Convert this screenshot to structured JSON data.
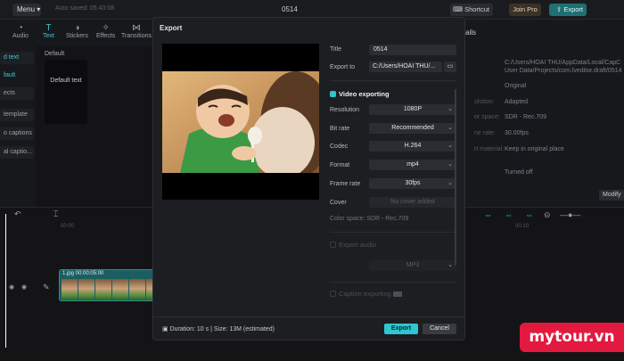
{
  "topbar": {
    "menu": "Menu",
    "autosave": "Auto saved: 05:43:08",
    "project": "0514",
    "shortcut": "Shortcut",
    "join_pro": "Join Pro",
    "export": "Export"
  },
  "toolbar": {
    "items": [
      {
        "label": "Audio",
        "icon": "audio-icon"
      },
      {
        "label": "Text",
        "icon": "text-icon"
      },
      {
        "label": "Stickers",
        "icon": "stickers-icon"
      },
      {
        "label": "Effects",
        "icon": "effects-icon"
      },
      {
        "label": "Transitions",
        "icon": "transitions-icon"
      }
    ]
  },
  "sidebar": {
    "items": [
      "d text",
      "fault",
      "ects",
      "template",
      "o captions",
      "al captio..."
    ]
  },
  "panel": {
    "default_label": "Default",
    "default_card": "Default text"
  },
  "details": {
    "title": "ails",
    "rows": [
      {
        "label": "",
        "value": "C:/Users/HOAI THU/AppData/Local/CapC"
      },
      {
        "label": "",
        "value": "User Data/Projects/com.lveditor.draft/0514"
      },
      {
        "label": "",
        "value": "Original"
      },
      {
        "label": "olution:",
        "value": "Adapted"
      },
      {
        "label": "or space:",
        "value": "SDR - Rec.709"
      },
      {
        "label": "ne rate:",
        "value": "30.00fps"
      },
      {
        "label": "rt material:",
        "value": "Keep in original place"
      },
      {
        "label": "",
        "value": "Turned off"
      }
    ],
    "modify": "Modify"
  },
  "timeline": {
    "times": [
      "00:00",
      "00:10"
    ],
    "clip_label": "1.jpg  00:00:05:00"
  },
  "modal": {
    "title": "Export",
    "fields": {
      "title_label": "Title",
      "title_value": "0514",
      "export_to_label": "Export to",
      "export_to_value": "C:/Users/HOAI THU/..."
    },
    "video_section": "Video exporting",
    "settings": [
      {
        "label": "Resolution",
        "value": "1080P"
      },
      {
        "label": "Bit rate",
        "value": "Recommended"
      },
      {
        "label": "Codec",
        "value": "H.264"
      },
      {
        "label": "Format",
        "value": "mp4"
      },
      {
        "label": "Frame rate",
        "value": "30fps"
      },
      {
        "label": "Cover",
        "value": "No cover added"
      }
    ],
    "color_space": "Color space: SDR - Rec.709",
    "audio_section": "Export audio",
    "audio_format": "MP3",
    "caption_section": "Caption exporting",
    "info": "Duration: 10 s | Size: 13M (estimated)",
    "export_btn": "Export",
    "cancel_btn": "Cancel"
  },
  "colors": {
    "accent": "#2ec6d0",
    "modal_bg": "#1d1e22",
    "watermark": "#e4193f"
  },
  "watermark": "mytour.vn"
}
